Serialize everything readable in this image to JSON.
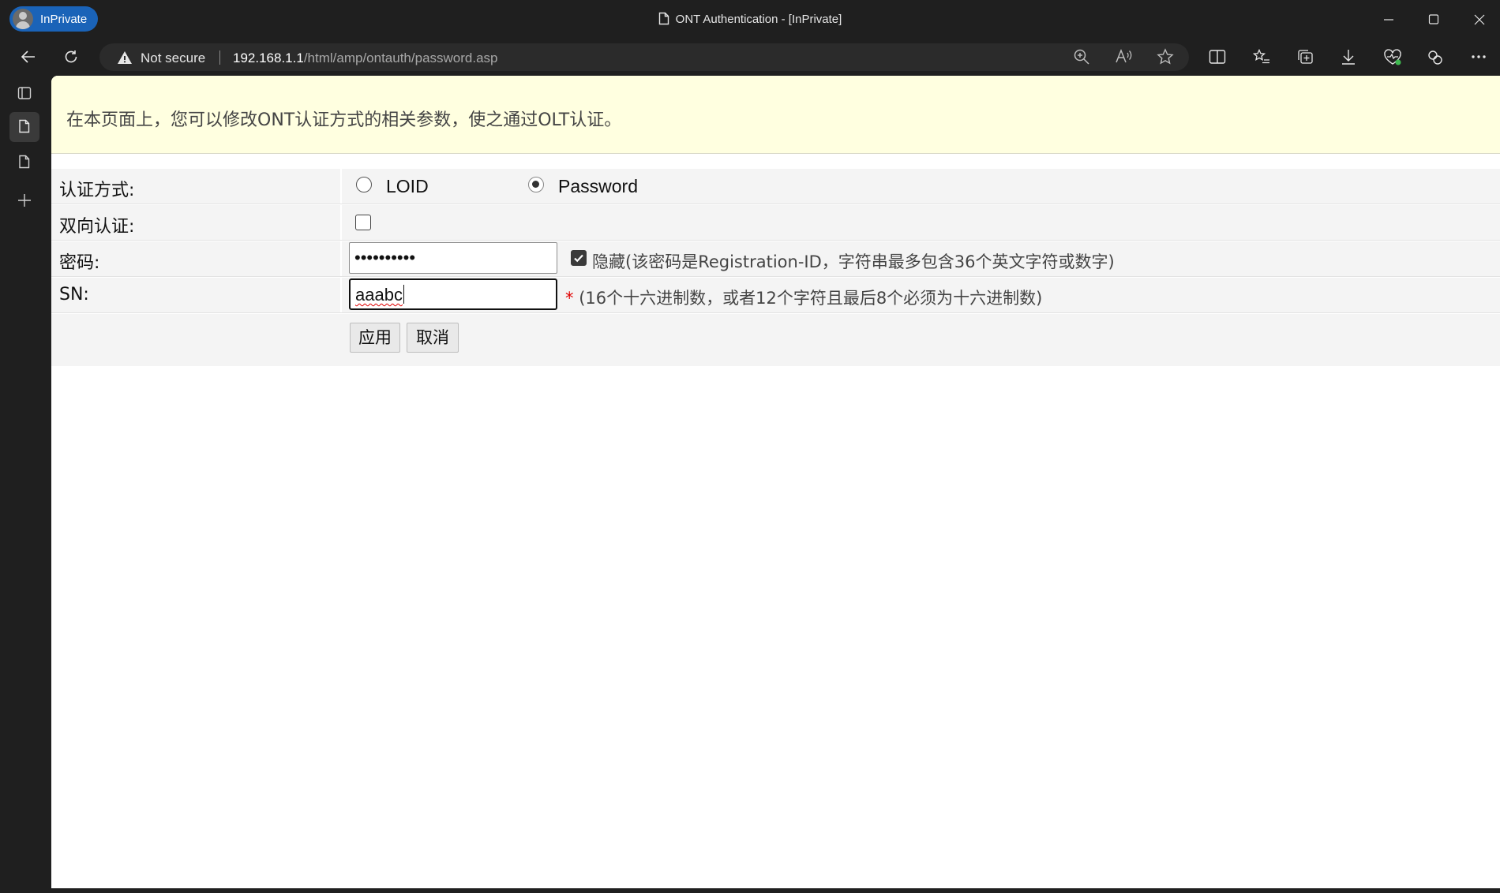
{
  "browser": {
    "profile_badge": "InPrivate",
    "window_title": "ONT Authentication - [InPrivate]",
    "security_label": "Not secure",
    "url_host": "192.168.1.1",
    "url_path": "/html/amp/ontauth/password.asp"
  },
  "page": {
    "notice": "在本页面上，您可以修改ONT认证方式的相关参数，使之通过OLT认证。",
    "auth_mode": {
      "label": "认证方式:",
      "options": [
        "LOID",
        "Password"
      ],
      "selected": "Password"
    },
    "mutual_auth": {
      "label": "双向认证:",
      "checked": false
    },
    "password": {
      "label": "密码:",
      "masked_value": "••••••••••",
      "hide_checked": true,
      "hide_hint": "隐藏(该密码是Registration-ID，字符串最多包含36个英文字符或数字)"
    },
    "sn": {
      "label": "SN:",
      "value": "aaabc",
      "required_mark": "*",
      "hint": "(16个十六进制数，或者12个字符且最后8个必须为十六进制数)"
    },
    "buttons": {
      "apply": "应用",
      "cancel": "取消"
    }
  }
}
